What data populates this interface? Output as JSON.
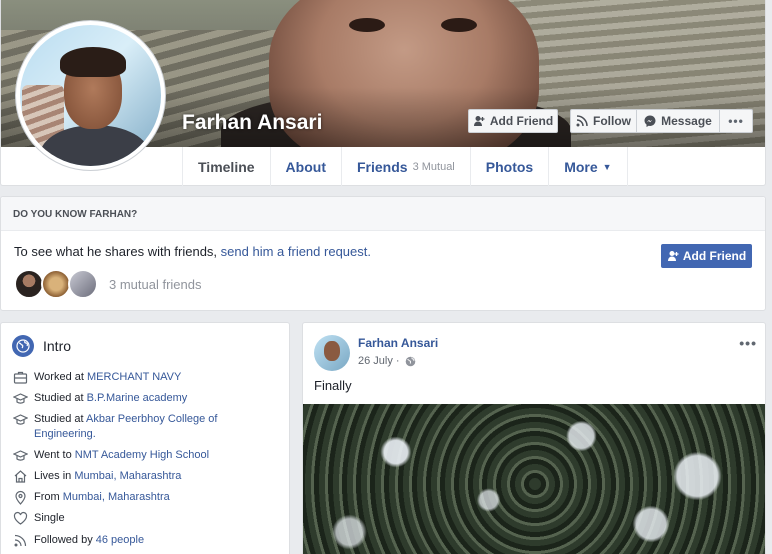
{
  "profile": {
    "name": "Farhan Ansari",
    "actions": {
      "add_friend": "Add Friend",
      "follow": "Follow",
      "message": "Message",
      "more": "•••"
    }
  },
  "tabs": [
    {
      "label": "Timeline",
      "active": true
    },
    {
      "label": "About"
    },
    {
      "label": "Friends",
      "sub": "3 Mutual"
    },
    {
      "label": "Photos"
    },
    {
      "label": "More"
    }
  ],
  "know": {
    "header": "DO YOU KNOW FARHAN?",
    "text_prefix": "To see what he shares with friends, ",
    "link": "send him a friend request.",
    "button": "Add Friend",
    "mutual": "3 mutual friends"
  },
  "intro": {
    "title": "Intro",
    "items": [
      {
        "icon": "briefcase-icon",
        "prefix": "Worked at ",
        "link": "MERCHANT NAVY"
      },
      {
        "icon": "graduation-cap-icon",
        "prefix": "Studied at ",
        "link": "B.P.Marine academy"
      },
      {
        "icon": "graduation-cap-icon",
        "prefix": "Studied at ",
        "link": "Akbar Peerbhoy College of Engineering."
      },
      {
        "icon": "graduation-cap-icon",
        "prefix": "Went to ",
        "link": "NMT Academy High School"
      },
      {
        "icon": "home-icon",
        "prefix": "Lives in ",
        "link": "Mumbai, Maharashtra"
      },
      {
        "icon": "location-pin-icon",
        "prefix": "From ",
        "link": "Mumbai, Maharashtra"
      },
      {
        "icon": "heart-icon",
        "prefix": "Single",
        "link": ""
      },
      {
        "icon": "rss-icon",
        "prefix": "Followed by ",
        "link": "46 people"
      }
    ]
  },
  "post": {
    "author": "Farhan Ansari",
    "date": "26 July ·",
    "menu": "•••",
    "text": "Finally"
  },
  "colors": {
    "facebook_blue": "#4267b2",
    "link_blue": "#365899",
    "page_bg": "#e9ebee"
  }
}
